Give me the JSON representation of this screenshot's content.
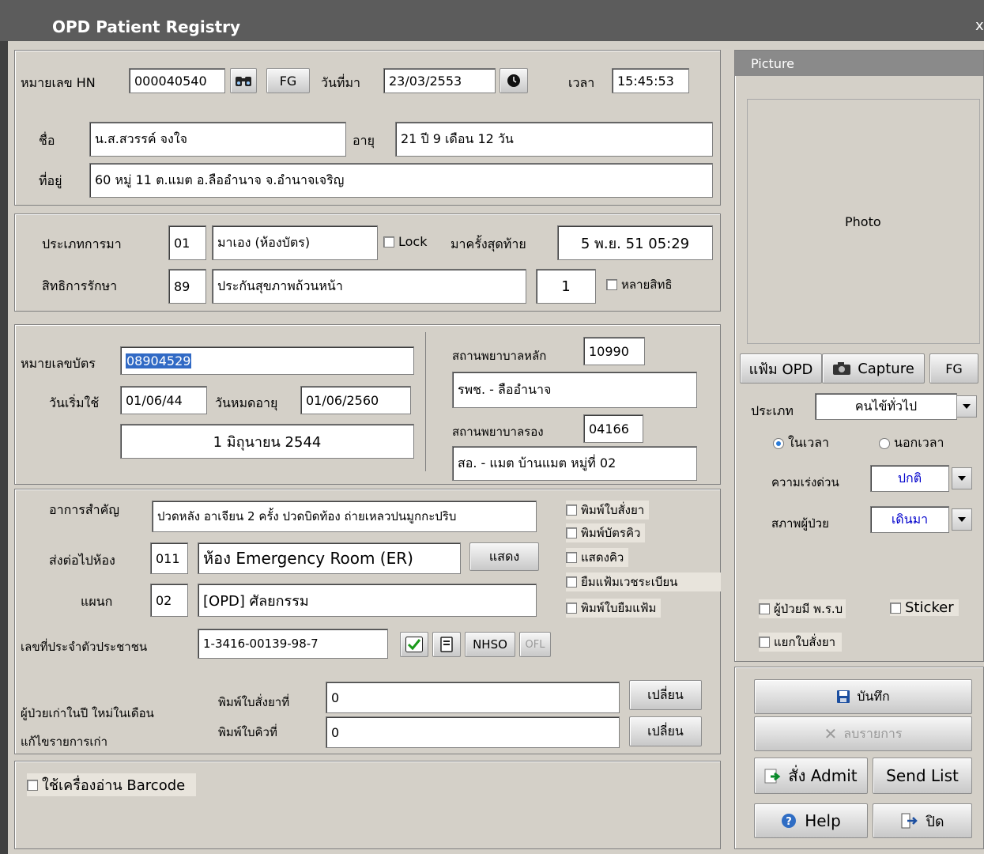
{
  "window": {
    "title": "OPD Patient Registry",
    "close": "x"
  },
  "header": {
    "hn_label": "หมายเลข HN",
    "hn_value": "000040540",
    "fg_button": "FG",
    "visit_date_label": "วันที่มา",
    "visit_date": "23/03/2553",
    "time_label": "เวลา",
    "time_value": "15:45:53",
    "name_label": "ชื่อ",
    "name_value": "น.ส.สวรรค์ จงใจ",
    "age_label": "อายุ",
    "age_value": "21 ปี 9 เดือน 12 วัน",
    "address_label": "ที่อยู่",
    "address_value": "60 หมู่ 11 ต.แมต อ.ลืออำนาจ จ.อำนาจเจริญ"
  },
  "visit": {
    "type_label": "ประเภทการมา",
    "type_code": "01",
    "type_name": "มาเอง (ห้องบัตร)",
    "lock_label": "Lock",
    "last_visit_label": "มาครั้งสุดท้าย",
    "last_visit_value": "5 พ.ย. 51 05:29",
    "right_label": "สิทธิการรักษา",
    "right_code": "89",
    "right_name": "ประกันสุขภาพถ้วนหน้า",
    "right_count": "1",
    "multi_right_label": "หลายสิทธิ"
  },
  "card": {
    "card_no_label": "หมายเลขบัตร",
    "card_no_value": "08904529",
    "start_label": "วันเริ่มใช้",
    "start_value": "01/06/44",
    "expire_label": "วันหมดอายุ",
    "expire_value": "01/06/2560",
    "start_full": "1 มิถุนายน 2544",
    "main_hosp_label": "สถานพยาบาลหลัก",
    "main_hosp_code": "10990",
    "main_hosp_name": "รพช. - ลืออำนาจ",
    "sub_hosp_label": "สถานพยาบาลรอง",
    "sub_hosp_code": "04166",
    "sub_hosp_name": "สอ. - แมต บ้านแมต หมู่ที่ 02"
  },
  "symptom": {
    "symptom_label": "อาการสำคัญ",
    "symptom_value": "ปวดหลัง อาเจียน 2 ครั้ง ปวดบิดท้อง ถ่ายเหลวปนมูกกะปริบ",
    "room_label": "ส่งต่อไปห้อง",
    "room_code": "011",
    "room_name": "ห้อง Emergency Room (ER)",
    "show_button": "แสดง",
    "dept_label": "แผนก",
    "dept_code": "02",
    "dept_name": "[OPD] ศัลยกรรม",
    "cid_label": "เลขที่ประจำตัวประชาชน",
    "cid_value": "1-3416-00139-98-7",
    "nhso_button": "NHSO",
    "ofl_button": "OFL",
    "opt1": "พิมพ์ใบสั่งยา",
    "opt2": "พิมพ์บัตรคิว",
    "opt3": "แสดงคิว",
    "opt4": "ยืมแฟ้มเวชระเบียน",
    "opt5": "พิมพ์ใบยืมแฟ้ม",
    "status_line1": "ผู้ป่วยเก่าในปี ใหม่ในเดือน",
    "status_line2": "แก้ไขรายการเก่า",
    "print_rx_label": "พิมพ์ใบสั่งยาที่",
    "print_rx_value": "0",
    "print_q_label": "พิมพ์ใบคิวที่",
    "print_q_value": "0",
    "change_button": "เปลี่ยน"
  },
  "barcode": {
    "label": "ใช้เครื่องอ่าน Barcode"
  },
  "picture": {
    "header": "Picture",
    "photo_label": "Photo",
    "opd_button": "แฟ้ม OPD",
    "capture_button": "Capture",
    "fg_button": "FG",
    "type_label": "ประเภท",
    "type_value": "คนไข้ทั่วไป",
    "in_time": "ในเวลา",
    "out_time": "นอกเวลา",
    "urgency_label": "ความเร่งด่วน",
    "urgency_value": "ปกติ",
    "condition_label": "สภาพผู้ป่วย",
    "condition_value": "เดินมา",
    "prb_label": "ผู้ป่วยมี พ.ร.บ",
    "sticker_label": "Sticker",
    "split_rx_label": "แยกใบสั่งยา"
  },
  "actions": {
    "save": "บันทึก",
    "delete": "ลบรายการ",
    "admit": "สั่ง Admit",
    "send_list": "Send List",
    "help": "Help",
    "close": "ปิด"
  },
  "colors": {
    "accent_blue": "#0000cc",
    "titlebar": "#5c5c5c",
    "panel": "#d4d0c8"
  }
}
